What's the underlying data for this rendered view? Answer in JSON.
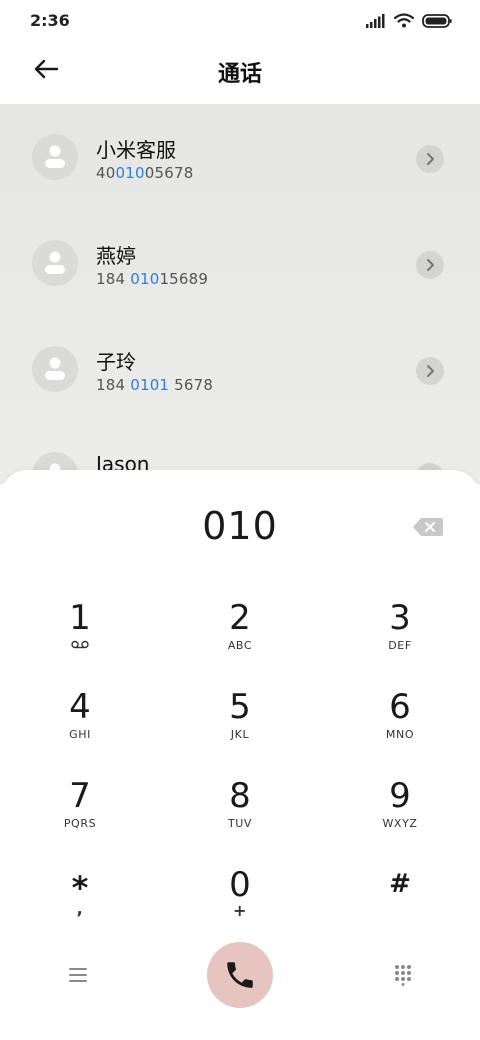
{
  "status_bar": {
    "time": "2:36"
  },
  "header": {
    "title": "通话"
  },
  "contacts": [
    {
      "name": "小米客服",
      "number_parts": [
        "40",
        "010",
        "05678"
      ]
    },
    {
      "name": "燕婷",
      "number_parts": [
        "184 ",
        "010",
        "15689"
      ]
    },
    {
      "name": "子玲",
      "number_parts": [
        "184 ",
        "0101",
        " 5678"
      ]
    },
    {
      "name": "Jason"
    }
  ],
  "dialer": {
    "input_value": "010",
    "keys": [
      {
        "digit": "1",
        "letters": ""
      },
      {
        "digit": "2",
        "letters": "ABC"
      },
      {
        "digit": "3",
        "letters": "DEF"
      },
      {
        "digit": "4",
        "letters": "GHI"
      },
      {
        "digit": "5",
        "letters": "JKL"
      },
      {
        "digit": "6",
        "letters": "MNO"
      },
      {
        "digit": "7",
        "letters": "PQRS"
      },
      {
        "digit": "8",
        "letters": "TUV"
      },
      {
        "digit": "9",
        "letters": "WXYZ"
      },
      {
        "digit": "*",
        "letters": ","
      },
      {
        "digit": "0",
        "letters": "+"
      },
      {
        "digit": "#",
        "letters": ""
      }
    ]
  },
  "colors": {
    "highlight": "#2e7fd6",
    "call_button": "#e6c4c0",
    "contacts_bg": "#e9e9e7"
  },
  "icons": {
    "back": "arrow-left-icon",
    "backspace": "backspace-icon",
    "voicemail": "voicemail-icon",
    "menu": "menu-icon",
    "call": "phone-icon",
    "keypad": "keypad-icon",
    "chevron": "chevron-right-icon",
    "avatar": "person-icon"
  }
}
